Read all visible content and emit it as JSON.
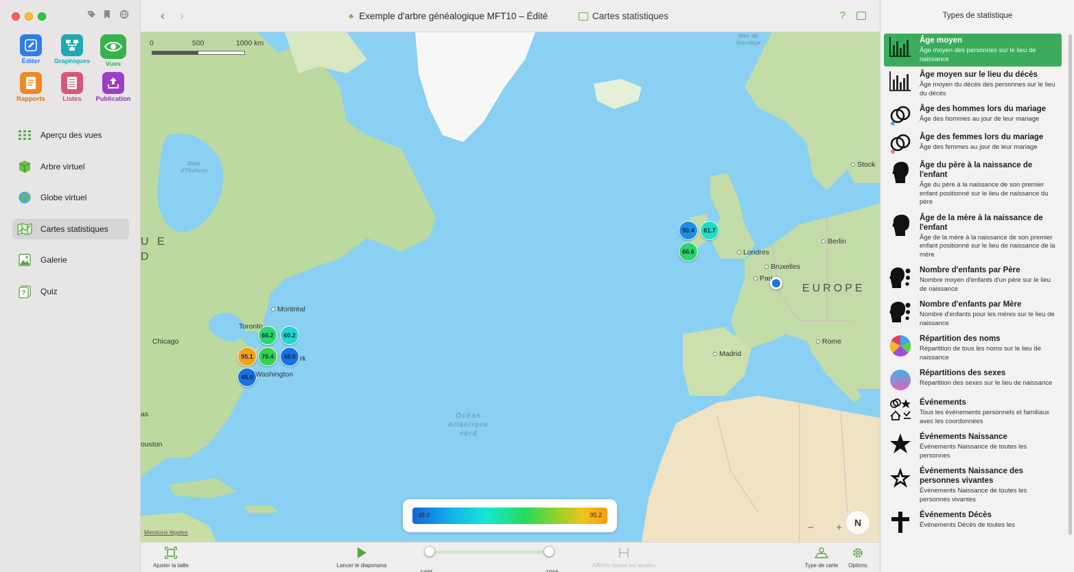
{
  "toolbar": {
    "tools": [
      {
        "label": "Éditer",
        "icon": "pencil-icon",
        "color": "#2f7ee8",
        "text_color": "#2f7ee8"
      },
      {
        "label": "Graphiques",
        "icon": "tree-chart-icon",
        "color": "#20a9b4",
        "text_color": "#20a9b4"
      },
      {
        "label": "Vues",
        "icon": "eye-icon",
        "color": "#37b24d",
        "text_color": "#37b24d"
      },
      {
        "label": "Rapports",
        "icon": "report-icon",
        "color": "#ec8a26",
        "text_color": "#d07a22"
      },
      {
        "label": "Listes",
        "icon": "list-icon",
        "color": "#d9567a",
        "text_color": "#c04d6b"
      },
      {
        "label": "Publication",
        "icon": "upload-icon",
        "color": "#9d3ec8",
        "text_color": "#8a36b2"
      }
    ]
  },
  "sidebar": {
    "items": [
      {
        "label": "Aperçu des vues",
        "icon": "grid-icon",
        "active": false
      },
      {
        "label": "Arbre virtuel",
        "icon": "cube-icon",
        "active": false
      },
      {
        "label": "Globe virtuel",
        "icon": "globe-icon",
        "active": false
      },
      {
        "label": "Cartes statistiques",
        "icon": "map-icon",
        "active": true
      },
      {
        "label": "Galerie",
        "icon": "gallery-icon",
        "active": false
      },
      {
        "label": "Quiz",
        "icon": "quiz-icon",
        "active": false
      }
    ]
  },
  "window": {
    "title": "Exemple d'arbre généalogique MFT10 – Édité",
    "subtitle": "Cartes statistiques",
    "help": "?"
  },
  "map": {
    "scale": {
      "labels": [
        "0",
        "500",
        "1000 km"
      ]
    },
    "places": {
      "baie": "Baie\nd'Hudson",
      "norvege": "Mer de\nNorvège",
      "ocean": "Océan\nAtlantique\nnord",
      "europe": "EUROPE",
      "ue": "U E",
      "d": "D",
      "as": "as",
      "ouston": "ouston",
      "stock": "Stock",
      "londres": "Londres",
      "berlin": "Berlin",
      "bruxelles": "Bruxelles",
      "paris": "Pari",
      "madrid": "Madrid",
      "rome": "Rome",
      "montreal": "Montréal",
      "toronto": "Toronto",
      "chicago": "Chicago",
      "washington": "Washington",
      "york": "rk"
    },
    "markers": [
      {
        "value": "50.4",
        "color": "#1b8fe8"
      },
      {
        "value": "61.7",
        "color": "#1fdcc2"
      },
      {
        "value": "66.6",
        "color": "#2bd668"
      },
      {
        "value": "66.2",
        "color": "#29d86e"
      },
      {
        "value": "60.2",
        "color": "#1fd6d0"
      },
      {
        "value": "95.1",
        "color": "#f3a118"
      },
      {
        "value": "70.4",
        "color": "#33d24a"
      },
      {
        "value": "48.0",
        "color": "#1672e6"
      },
      {
        "value": "48.0",
        "color": "#1672e6"
      }
    ],
    "legend": {
      "min": "48.0",
      "max": "95.2"
    },
    "legal": "Mentions légales",
    "zoom_out": "−",
    "zoom_in": "+",
    "compass": "N"
  },
  "bottombar": {
    "fit_label": "Ajuster la taille",
    "slideshow_label": "Lancer le diaporama",
    "year_start": "1665",
    "year_end": "1966",
    "slider_start_fraction": 0.0,
    "slider_end_fraction": 1.0,
    "all_years_label": "Afficher toutes les années",
    "map_type_label": "Type de carte",
    "options_label": "Options"
  },
  "panel": {
    "title": "Types de statistique",
    "stats": [
      {
        "name": "Âge moyen",
        "desc": "Âge moyen des personnes sur le lieu de naissance",
        "icon": "bar-chart-icon",
        "active": true
      },
      {
        "name": "Âge moyen sur le lieu du décès",
        "desc": "Âge moyen du décès des personnes sur le lieu du décès",
        "icon": "bar-chart-icon",
        "active": false
      },
      {
        "name": "Âge des hommes lors du mariage",
        "desc": "Âge des hommes au jour de leur mariage",
        "icon": "rings-male-icon",
        "active": false
      },
      {
        "name": "Âge des femmes lors du mariage",
        "desc": "Âge des femmes au jour de leur mariage",
        "icon": "rings-female-icon",
        "active": false
      },
      {
        "name": "Âge du père à la naissance de l'enfant",
        "desc": "Âge du père à la naissance de son premier enfant positionné sur le lieu de naissance du père",
        "icon": "male-head-icon",
        "active": false
      },
      {
        "name": "Âge de la mère à la naissance de l'enfant",
        "desc": "Âge de la mère à la naissance de son premier enfant positionné sur le lieu de naissance de la mère",
        "icon": "female-head-icon",
        "active": false
      },
      {
        "name": "Nombre d'enfants par Père",
        "desc": "Nombre moyen d'enfants d'un père sur le lieu de naissance",
        "icon": "father-children-icon",
        "active": false
      },
      {
        "name": "Nombre d'enfants par Mère",
        "desc": "Nombre d'enfants pour les mères sur le lieu de naissance",
        "icon": "mother-children-icon",
        "active": false
      },
      {
        "name": "Répartition des noms",
        "desc": "Répartition de tous les noms sur le lieu de naissance",
        "icon": "pie-names-icon",
        "active": false
      },
      {
        "name": "Répartitions des sexes",
        "desc": "Répartition des sexes sur le lieu de naissance",
        "icon": "pie-sexes-icon",
        "active": false
      },
      {
        "name": "Événements",
        "desc": "Tous les événements personnels et familiaux avec les coordonnées",
        "icon": "events-icon",
        "active": false
      },
      {
        "name": "Événements Naissance",
        "desc": "Événements Naissance de toutes les personnes",
        "icon": "star-icon",
        "active": false
      },
      {
        "name": "Événements Naissance des personnes vivantes",
        "desc": "Événements Naissance de toutes les personnes vivantes",
        "icon": "star-outline-icon",
        "active": false
      },
      {
        "name": "Événements Décès",
        "desc": "Événements Décès de toutes les",
        "icon": "cross-icon",
        "active": false
      }
    ]
  }
}
